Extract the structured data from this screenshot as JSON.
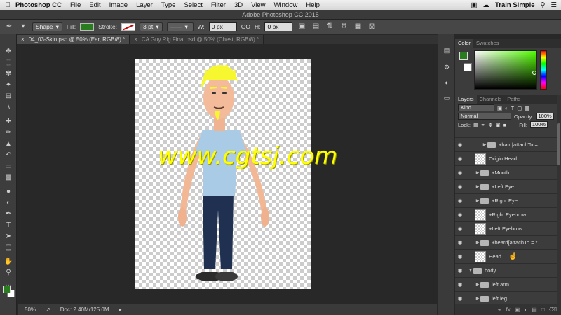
{
  "menubar": {
    "apple": "",
    "app": "Photoshop CC",
    "items": [
      "File",
      "Edit",
      "Image",
      "Layer",
      "Type",
      "Select",
      "Filter",
      "3D",
      "View",
      "Window",
      "Help"
    ],
    "user": "Train Simple"
  },
  "window_title": "Adobe Photoshop CC 2015",
  "options": {
    "mode": "Shape",
    "fill_label": "Fill:",
    "stroke_label": "Stroke:",
    "stroke_width": "3 pt",
    "w_label": "W:",
    "w_value": "0 px",
    "go_label": "GO",
    "h_label": "H:",
    "h_value": "0 px"
  },
  "tabs": [
    {
      "label": "04_03-Skin.psd @ 50% (Ear, RGB/8) *",
      "active": true
    },
    {
      "label": "CA Guy Rig Final.psd @ 50% (Chest, RGB/8) *",
      "active": false
    }
  ],
  "canvas": {
    "watermark": "www.cgtsj.com"
  },
  "status": {
    "zoom": "50%",
    "doc": "Doc: 2.40M/125.0M"
  },
  "color_panel": {
    "tabs": [
      "Color",
      "Swatches"
    ],
    "fg_color": "#2a7d1e"
  },
  "layers_panel": {
    "tabs": [
      "Layers",
      "Channels",
      "Paths"
    ],
    "kind": "Kind",
    "blend_mode": "Normal",
    "opacity_label": "Opacity:",
    "opacity": "100%",
    "lock_label": "Lock:",
    "fill_label": "Fill:",
    "fill": "100%",
    "layers": [
      {
        "name": "+hair [attachTo =...",
        "type": "folder",
        "indent": 2
      },
      {
        "name": "Origin Head",
        "type": "layer",
        "indent": 1
      },
      {
        "name": "+Mouth",
        "type": "folder",
        "indent": 1
      },
      {
        "name": "+Left Eye",
        "type": "folder",
        "indent": 1
      },
      {
        "name": "+Right Eye",
        "type": "folder",
        "indent": 1
      },
      {
        "name": "+Right Eyebrow",
        "type": "layer",
        "indent": 1
      },
      {
        "name": "+Left Eyebrow",
        "type": "layer",
        "indent": 1
      },
      {
        "name": "+beard[attachTo = *...",
        "type": "folder",
        "indent": 1
      },
      {
        "name": "Head",
        "type": "layer",
        "indent": 1
      },
      {
        "name": "body",
        "type": "folder",
        "indent": 0
      },
      {
        "name": "left arm",
        "type": "folder",
        "indent": 1
      },
      {
        "name": "left leg",
        "type": "folder",
        "indent": 1
      },
      {
        "name": "",
        "type": "layer",
        "indent": 2
      }
    ]
  }
}
